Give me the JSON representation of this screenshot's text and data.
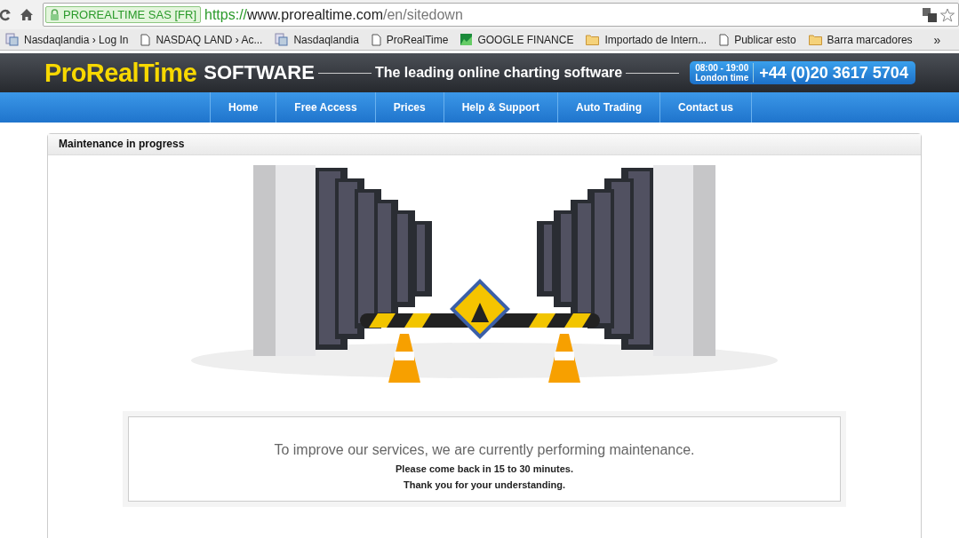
{
  "browser": {
    "security_label": "PROREALTIME SAS [FR]",
    "url_scheme": "https://",
    "url_host": "www.prorealtime.com",
    "url_path": "/en/sitedown",
    "overflow": "»"
  },
  "bookmarks": [
    {
      "label": "Nasdaqlandia › Log In",
      "kind": "app"
    },
    {
      "label": "NASDAQ LAND › Ac...",
      "kind": "page"
    },
    {
      "label": "Nasdaqlandia",
      "kind": "app"
    },
    {
      "label": "ProRealTime",
      "kind": "page"
    },
    {
      "label": "GOOGLE FINANCE",
      "kind": "finance"
    },
    {
      "label": "Importado de Intern...",
      "kind": "folder"
    },
    {
      "label": "Publicar esto",
      "kind": "page"
    },
    {
      "label": "Barra marcadores",
      "kind": "folder"
    }
  ],
  "header": {
    "logo_main": "ProRealTime",
    "logo_sub": "SOFTWARE",
    "tagline": "The leading online charting software",
    "hours": "08:00 - 19:00",
    "hours_place": "London time",
    "phone": "+44 (0)20 3617 5704"
  },
  "nav": [
    {
      "label": "Home"
    },
    {
      "label": "Free Access"
    },
    {
      "label": "Prices"
    },
    {
      "label": "Help & Support"
    },
    {
      "label": "Auto Trading"
    },
    {
      "label": "Contact us"
    }
  ],
  "panel": {
    "title": "Maintenance in progress",
    "message": "To improve our services, we are currently performing maintenance.",
    "line_2": "Please come back in 15 to 30 minutes.",
    "line_3": "Thank you for your understanding."
  }
}
